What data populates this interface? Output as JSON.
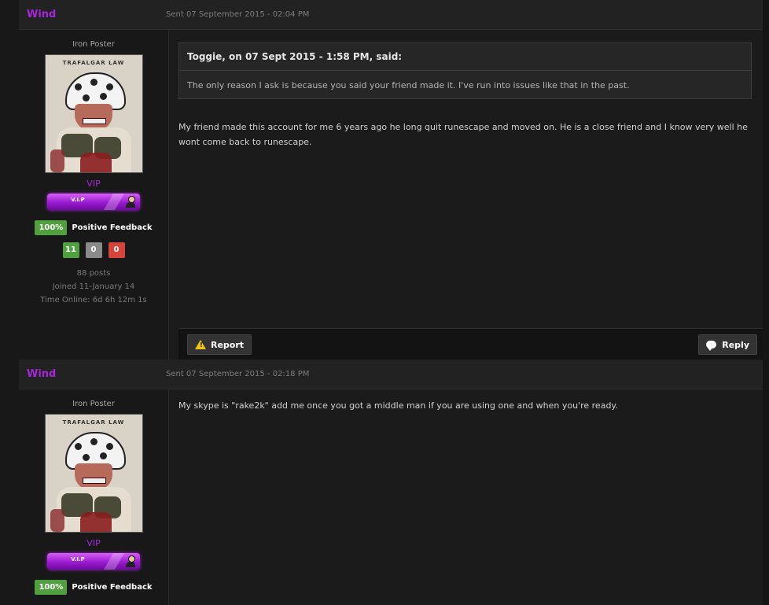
{
  "posts": [
    {
      "author": "Wind",
      "date": "Sent 07 September 2015 - 02:04 PM",
      "rank": "Iron Poster",
      "avatar_caption": "TRAFALGAR LAW",
      "group": "VIP",
      "vip_bar_label": "V.I.P",
      "feedback_percent": "100%",
      "feedback_label": "Positive Feedback",
      "feedback_positive": "11",
      "feedback_neutral": "0",
      "feedback_negative": "0",
      "posts_count": "88 posts",
      "joined": "Joined 11-January 14",
      "time_online": "Time Online: 6d 6h 12m 1s",
      "quote_citation": "Toggie, on 07 Sept 2015 - 1:58 PM, said:",
      "quote_text": "The only reason I ask is because you said your friend made it. I've run into issues like that in the past.",
      "text": "My friend made this account for me 6 years ago he long quit runescape and moved on. He is a close friend and I know very well he wont come back to runescape.",
      "report_label": "Report",
      "reply_label": "Reply"
    },
    {
      "author": "Wind",
      "date": "Sent 07 September 2015 - 02:18 PM",
      "rank": "Iron Poster",
      "avatar_caption": "TRAFALGAR LAW",
      "group": "VIP",
      "vip_bar_label": "V.I.P",
      "feedback_percent": "100%",
      "feedback_label": "Positive Feedback",
      "text": "My skype is \"rake2k\" add me once you got a middle man if you are using one and when you're ready."
    }
  ],
  "colors": {
    "author": "#a526d8",
    "positive": "#50a040",
    "negative": "#d6443a",
    "neutral": "#8a8a8a"
  },
  "icons": {
    "report": "warning-triangle-icon",
    "reply": "speech-bubble-icon"
  }
}
